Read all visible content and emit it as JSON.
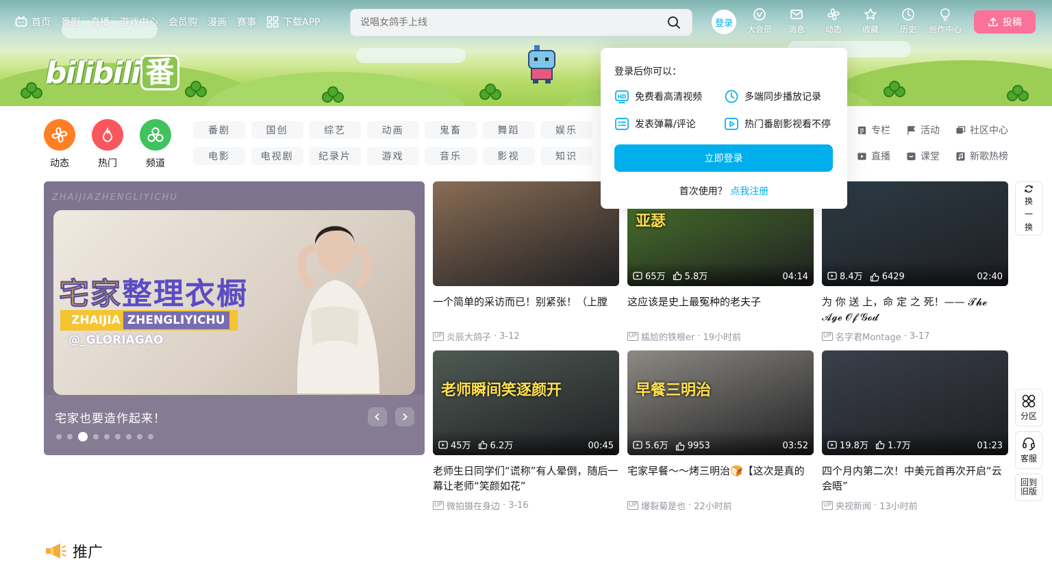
{
  "topnav": {
    "items": [
      {
        "label": "首页",
        "icon": "tv-icon"
      },
      {
        "label": "番剧"
      },
      {
        "label": "直播"
      },
      {
        "label": "游戏中心"
      },
      {
        "label": "会员购"
      },
      {
        "label": "漫画"
      },
      {
        "label": "赛事"
      },
      {
        "label": "下载APP",
        "icon": "app-grid-icon"
      }
    ]
  },
  "search": {
    "placeholder": "说唱女鸽手上线"
  },
  "user": {
    "login_label": "登录",
    "items": [
      {
        "label": "大会员",
        "icon": "vip-icon"
      },
      {
        "label": "消息",
        "icon": "mail-icon"
      },
      {
        "label": "动态",
        "icon": "windmill-icon"
      },
      {
        "label": "收藏",
        "icon": "star-icon"
      },
      {
        "label": "历史",
        "icon": "clock-icon"
      },
      {
        "label": "创作中心",
        "icon": "bulb-icon"
      }
    ],
    "upload_label": "投稿"
  },
  "banner": {
    "logo_text": "bilibili",
    "logo_badge": "番"
  },
  "channels": {
    "quick": [
      {
        "label": "动态",
        "color": "#ff7f24"
      },
      {
        "label": "热门",
        "color": "#f9575d"
      },
      {
        "label": "频道",
        "color": "#40c35f"
      }
    ],
    "chips": [
      "番剧",
      "国创",
      "综艺",
      "动画",
      "鬼畜",
      "舞蹈",
      "娱乐",
      "电影",
      "电视剧",
      "纪录片",
      "游戏",
      "音乐",
      "影视",
      "知识"
    ],
    "links": [
      {
        "label": "专栏",
        "icon": "column-icon"
      },
      {
        "label": "活动",
        "icon": "flag-icon"
      },
      {
        "label": "社区中心",
        "icon": "community-icon"
      },
      {
        "label": "直播",
        "icon": "live-icon"
      },
      {
        "label": "课堂",
        "icon": "class-icon"
      },
      {
        "label": "新歌热榜",
        "icon": "music-icon"
      }
    ]
  },
  "carousel": {
    "watermark": "ZHAIJIAZHENGLIYICHU",
    "headline_a": "宅家",
    "headline_b": "整理衣橱",
    "tag_a": "ZHAIJIA",
    "tag_b": "ZHENGLIYICHU",
    "handle": "@_GLORIAGAO",
    "caption": "宅家也要造作起来！",
    "active_slide": 3,
    "slide_count": 9
  },
  "videos": [
    {
      "title": "一个简单的采访而已！别紧张！（上膛",
      "author": "炎辰大鸽子",
      "date": "3-12",
      "views": "",
      "likes": "",
      "duration": "",
      "thumb_color": "#8a6d55"
    },
    {
      "title": "这应该是史上最冤种的老夫子",
      "author": "尴尬的铁根er",
      "date": "19小时前",
      "views": "65万",
      "likes": "5.8万",
      "duration": "04:14",
      "thumb_color": "#4d7a2b",
      "thumb_text": "亚瑟"
    },
    {
      "title": "为 你 送 上，命 定 之 死！—— 𝓣𝓱𝓮 𝓐𝓰𝓮 𝓞𝓯 𝓖𝓸𝓭",
      "author": "名字君Montage",
      "date": "3-17",
      "views": "8.4万",
      "likes": "6429",
      "duration": "02:40",
      "thumb_color": "#2d3b45"
    },
    {
      "title": "老师生日同学们“谎称”有人晕倒，随后一幕让老师“笑颜如花”",
      "author": "微拍摄在身边",
      "date": "3-16",
      "views": "45万",
      "likes": "6.2万",
      "duration": "00:45",
      "thumb_color": "#4f5a54",
      "thumb_text": "老师瞬间笑逐颜开"
    },
    {
      "title": "宅家早餐～～烤三明治🍞【这次是真的",
      "author": "爆裂菊是也",
      "date": "22小时前",
      "views": "5.6万",
      "likes": "9953",
      "duration": "03:52",
      "thumb_color": "#8d8a84",
      "thumb_text": "早餐三明治"
    },
    {
      "title": "四个月内第二次！中美元首再次开启“云会晤”",
      "author": "央视新闻",
      "date": "13小时前",
      "views": "19.8万",
      "likes": "1.7万",
      "duration": "01:23",
      "thumb_color": "#3a3f4a"
    }
  ],
  "login_popup": {
    "title": "登录后你可以：",
    "benefits": [
      {
        "label": "免费看高清视频",
        "icon": "hd-icon"
      },
      {
        "label": "多端同步播放记录",
        "icon": "clock-icon"
      },
      {
        "label": "发表弹幕/评论",
        "icon": "danmaku-icon"
      },
      {
        "label": "热门番剧影视看不停",
        "icon": "play-icon"
      }
    ],
    "button": "立即登录",
    "register_prefix": "首次使用？",
    "register_link": "点我注册"
  },
  "side": {
    "refresh": "换一换",
    "refresh_lines": [
      "换",
      "一",
      "换"
    ],
    "zone": "分区",
    "service": "客服",
    "old_a": "回到",
    "old_b": "旧版"
  },
  "promo": {
    "label": "推广"
  },
  "colors": {
    "brand_blue": "#00aeec",
    "brand_pink": "#fb7299"
  }
}
